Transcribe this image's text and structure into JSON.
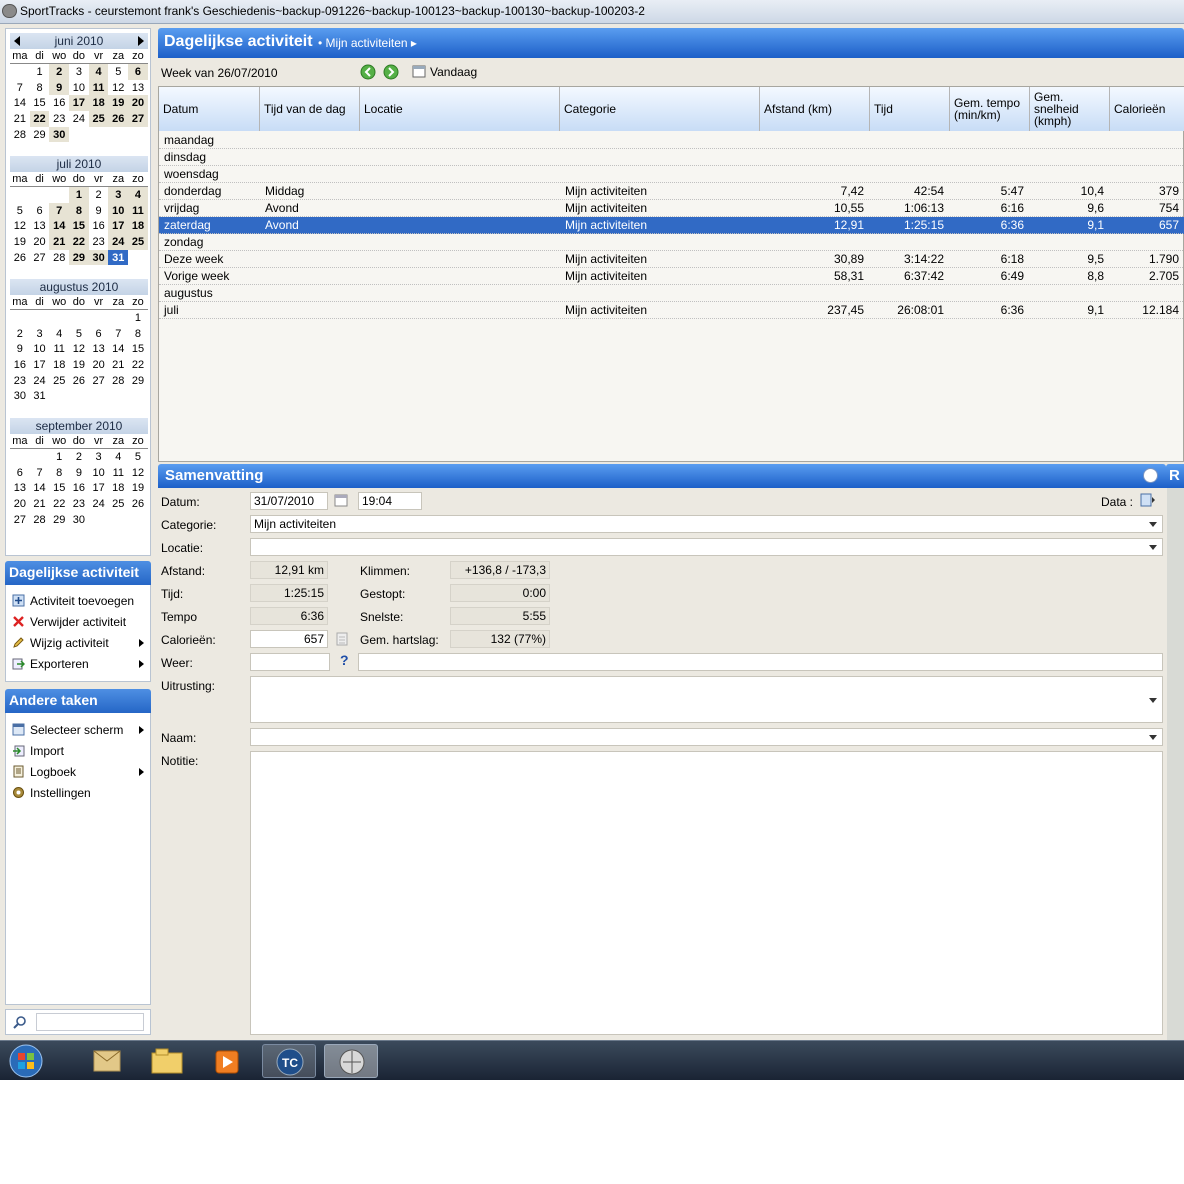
{
  "window": {
    "title": "SportTracks - ceurstemont frank's Geschiedenis~backup-091226~backup-100123~backup-100130~backup-100203-2"
  },
  "calendar": {
    "weekdays": [
      "ma",
      "di",
      "wo",
      "do",
      "vr",
      "za",
      "zo"
    ],
    "months": [
      {
        "title": "juni 2010",
        "arrows": true,
        "days": [
          [
            "",
            "",
            0
          ],
          [
            "1",
            "",
            0
          ],
          [
            "2",
            "b",
            0
          ],
          [
            "3",
            "",
            0
          ],
          [
            "4",
            "b",
            0
          ],
          [
            "5",
            "",
            0
          ],
          [
            "6",
            "b",
            0
          ],
          [
            "7",
            "",
            0
          ],
          [
            "8",
            "",
            0
          ],
          [
            "9",
            "b",
            0
          ],
          [
            "10",
            "",
            0
          ],
          [
            "11",
            "b",
            0
          ],
          [
            "12",
            "",
            0
          ],
          [
            "13",
            "",
            0
          ],
          [
            "14",
            "",
            0
          ],
          [
            "15",
            "",
            0
          ],
          [
            "16",
            "",
            0
          ],
          [
            "17",
            "b",
            0
          ],
          [
            "18",
            "b",
            0
          ],
          [
            "19",
            "b",
            0
          ],
          [
            "20",
            "b",
            0
          ],
          [
            "21",
            "",
            0
          ],
          [
            "22",
            "b",
            0
          ],
          [
            "23",
            "",
            0
          ],
          [
            "24",
            "",
            0
          ],
          [
            "25",
            "b",
            0
          ],
          [
            "26",
            "b",
            0
          ],
          [
            "27",
            "b",
            0
          ],
          [
            "28",
            "",
            0
          ],
          [
            "29",
            "",
            0
          ],
          [
            "30",
            "b",
            0
          ]
        ]
      },
      {
        "title": "juli 2010",
        "arrows": false,
        "days": [
          [
            "",
            "",
            0
          ],
          [
            "",
            "",
            0
          ],
          [
            "",
            "",
            0
          ],
          [
            "1",
            "b",
            0
          ],
          [
            "2",
            "",
            0
          ],
          [
            "3",
            "b",
            0
          ],
          [
            "4",
            "b",
            0
          ],
          [
            "5",
            "",
            0
          ],
          [
            "6",
            "",
            0
          ],
          [
            "7",
            "b",
            0
          ],
          [
            "8",
            "b",
            0
          ],
          [
            "9",
            "",
            0
          ],
          [
            "10",
            "b",
            0
          ],
          [
            "11",
            "b",
            0
          ],
          [
            "12",
            "",
            0
          ],
          [
            "13",
            "",
            0
          ],
          [
            "14",
            "b",
            0
          ],
          [
            "15",
            "b",
            0
          ],
          [
            "16",
            "",
            0
          ],
          [
            "17",
            "b",
            0
          ],
          [
            "18",
            "b",
            0
          ],
          [
            "19",
            "",
            0
          ],
          [
            "20",
            "",
            0
          ],
          [
            "21",
            "b",
            0
          ],
          [
            "22",
            "b",
            0
          ],
          [
            "23",
            "",
            0
          ],
          [
            "24",
            "b",
            0
          ],
          [
            "25",
            "b",
            0
          ],
          [
            "26",
            "",
            0
          ],
          [
            "27",
            "",
            0
          ],
          [
            "28",
            "",
            0
          ],
          [
            "29",
            "b",
            0
          ],
          [
            "30",
            "b",
            0
          ],
          [
            "31",
            "sel",
            0
          ]
        ]
      },
      {
        "title": "augustus 2010",
        "arrows": false,
        "days": [
          [
            "",
            "",
            0
          ],
          [
            "",
            "",
            0
          ],
          [
            "",
            "",
            0
          ],
          [
            "",
            "",
            0
          ],
          [
            "",
            "",
            0
          ],
          [
            "",
            "",
            0
          ],
          [
            "1",
            "",
            0
          ],
          [
            "2",
            "",
            0
          ],
          [
            "3",
            "",
            0
          ],
          [
            "4",
            "",
            0
          ],
          [
            "5",
            "",
            0
          ],
          [
            "6",
            "",
            0
          ],
          [
            "7",
            "",
            0
          ],
          [
            "8",
            "",
            0
          ],
          [
            "9",
            "",
            0
          ],
          [
            "10",
            "",
            0
          ],
          [
            "11",
            "",
            0
          ],
          [
            "12",
            "",
            0
          ],
          [
            "13",
            "",
            0
          ],
          [
            "14",
            "",
            0
          ],
          [
            "15",
            "",
            0
          ],
          [
            "16",
            "",
            0
          ],
          [
            "17",
            "",
            0
          ],
          [
            "18",
            "",
            0
          ],
          [
            "19",
            "",
            0
          ],
          [
            "20",
            "",
            0
          ],
          [
            "21",
            "",
            0
          ],
          [
            "22",
            "",
            0
          ],
          [
            "23",
            "",
            0
          ],
          [
            "24",
            "",
            0
          ],
          [
            "25",
            "",
            0
          ],
          [
            "26",
            "",
            0
          ],
          [
            "27",
            "",
            0
          ],
          [
            "28",
            "",
            0
          ],
          [
            "29",
            "",
            0
          ],
          [
            "30",
            "",
            0
          ],
          [
            "31",
            "",
            0
          ]
        ]
      },
      {
        "title": "september 2010",
        "arrows": false,
        "days": [
          [
            "",
            "",
            0
          ],
          [
            "",
            "",
            0
          ],
          [
            "1",
            "",
            0
          ],
          [
            "2",
            "",
            0
          ],
          [
            "3",
            "",
            0
          ],
          [
            "4",
            "",
            0
          ],
          [
            "5",
            "",
            0
          ],
          [
            "6",
            "",
            0
          ],
          [
            "7",
            "",
            0
          ],
          [
            "8",
            "",
            0
          ],
          [
            "9",
            "",
            0
          ],
          [
            "10",
            "",
            0
          ],
          [
            "11",
            "",
            0
          ],
          [
            "12",
            "",
            0
          ],
          [
            "13",
            "",
            0
          ],
          [
            "14",
            "",
            0
          ],
          [
            "15",
            "",
            0
          ],
          [
            "16",
            "",
            0
          ],
          [
            "17",
            "",
            0
          ],
          [
            "18",
            "",
            0
          ],
          [
            "19",
            "",
            0
          ],
          [
            "20",
            "",
            0
          ],
          [
            "21",
            "",
            0
          ],
          [
            "22",
            "",
            0
          ],
          [
            "23",
            "",
            0
          ],
          [
            "24",
            "",
            0
          ],
          [
            "25",
            "",
            0
          ],
          [
            "26",
            "",
            0
          ],
          [
            "27",
            "",
            0
          ],
          [
            "28",
            "",
            0
          ],
          [
            "29",
            "",
            0
          ],
          [
            "30",
            "",
            0
          ]
        ]
      }
    ]
  },
  "tasks1": {
    "title": "Dagelijkse activiteit",
    "items": [
      "Activiteit toevoegen",
      "Verwijder activiteit",
      "Wijzig activiteit",
      "Exporteren"
    ]
  },
  "tasks2": {
    "title": "Andere taken",
    "items": [
      "Selecteer scherm",
      "Import",
      "Logboek",
      "Instellingen"
    ]
  },
  "main": {
    "title": "Dagelijkse activiteit",
    "breadcrumb": "Mijn activiteiten",
    "week_label": "Week van 26/07/2010",
    "today": "Vandaag",
    "columns": [
      "Datum",
      "Tijd van de dag",
      "Locatie",
      "Categorie",
      "Afstand (km)",
      "Tijd",
      "Gem. tempo (min/km)",
      "Gem. snelheid (kmph)",
      "Calorieën"
    ],
    "rows": [
      [
        "maandag",
        "",
        "",
        "",
        "",
        "",
        "",
        "",
        ""
      ],
      [
        "dinsdag",
        "",
        "",
        "",
        "",
        "",
        "",
        "",
        ""
      ],
      [
        "woensdag",
        "",
        "",
        "",
        "",
        "",
        "",
        "",
        ""
      ],
      [
        "donderdag",
        "Middag",
        "",
        "Mijn activiteiten",
        "7,42",
        "42:54",
        "5:47",
        "10,4",
        "379"
      ],
      [
        "vrijdag",
        "Avond",
        "",
        "Mijn activiteiten",
        "10,55",
        "1:06:13",
        "6:16",
        "9,6",
        "754"
      ],
      [
        "zaterdag",
        "Avond",
        "",
        "Mijn activiteiten",
        "12,91",
        "1:25:15",
        "6:36",
        "9,1",
        "657"
      ],
      [
        "zondag",
        "",
        "",
        "",
        "",
        "",
        "",
        "",
        ""
      ],
      [
        "Deze week",
        "",
        "",
        "Mijn activiteiten",
        "30,89",
        "3:14:22",
        "6:18",
        "9,5",
        "1.790"
      ],
      [
        "Vorige week",
        "",
        "",
        "Mijn activiteiten",
        "58,31",
        "6:37:42",
        "6:49",
        "8,8",
        "2.705"
      ],
      [
        "augustus",
        "",
        "",
        "",
        "",
        "",
        "",
        "",
        ""
      ],
      [
        "juli",
        "",
        "",
        "Mijn activiteiten",
        "237,45",
        "26:08:01",
        "6:36",
        "9,1",
        "12.184"
      ]
    ],
    "selected_row": 5
  },
  "summary": {
    "title": "Samenvatting",
    "datum_label": "Datum:",
    "datum": "31/07/2010",
    "time": "19:04",
    "data_label": "Data :",
    "categorie_label": "Categorie:",
    "categorie": "Mijn activiteiten",
    "locatie_label": "Locatie:",
    "afstand_label": "Afstand:",
    "afstand": "12,91 km",
    "tijd_label": "Tijd:",
    "tijd": "1:25:15",
    "tempo_label": "Tempo",
    "tempo": "6:36",
    "calorieen_label": "Calorieën:",
    "calorieen": "657",
    "weer_label": "Weer:",
    "klimmen_label": "Klimmen:",
    "klimmen": "+136,8 / -173,3",
    "gestopt_label": "Gestopt:",
    "gestopt": "0:00",
    "snelste_label": "Snelste:",
    "snelste": "5:55",
    "hartslag_label": "Gem. hartslag:",
    "hartslag": "132 (77%)",
    "uitrusting_label": "Uitrusting:",
    "naam_label": "Naam:",
    "notitie_label": "Notitie:"
  },
  "right_tab": "R"
}
